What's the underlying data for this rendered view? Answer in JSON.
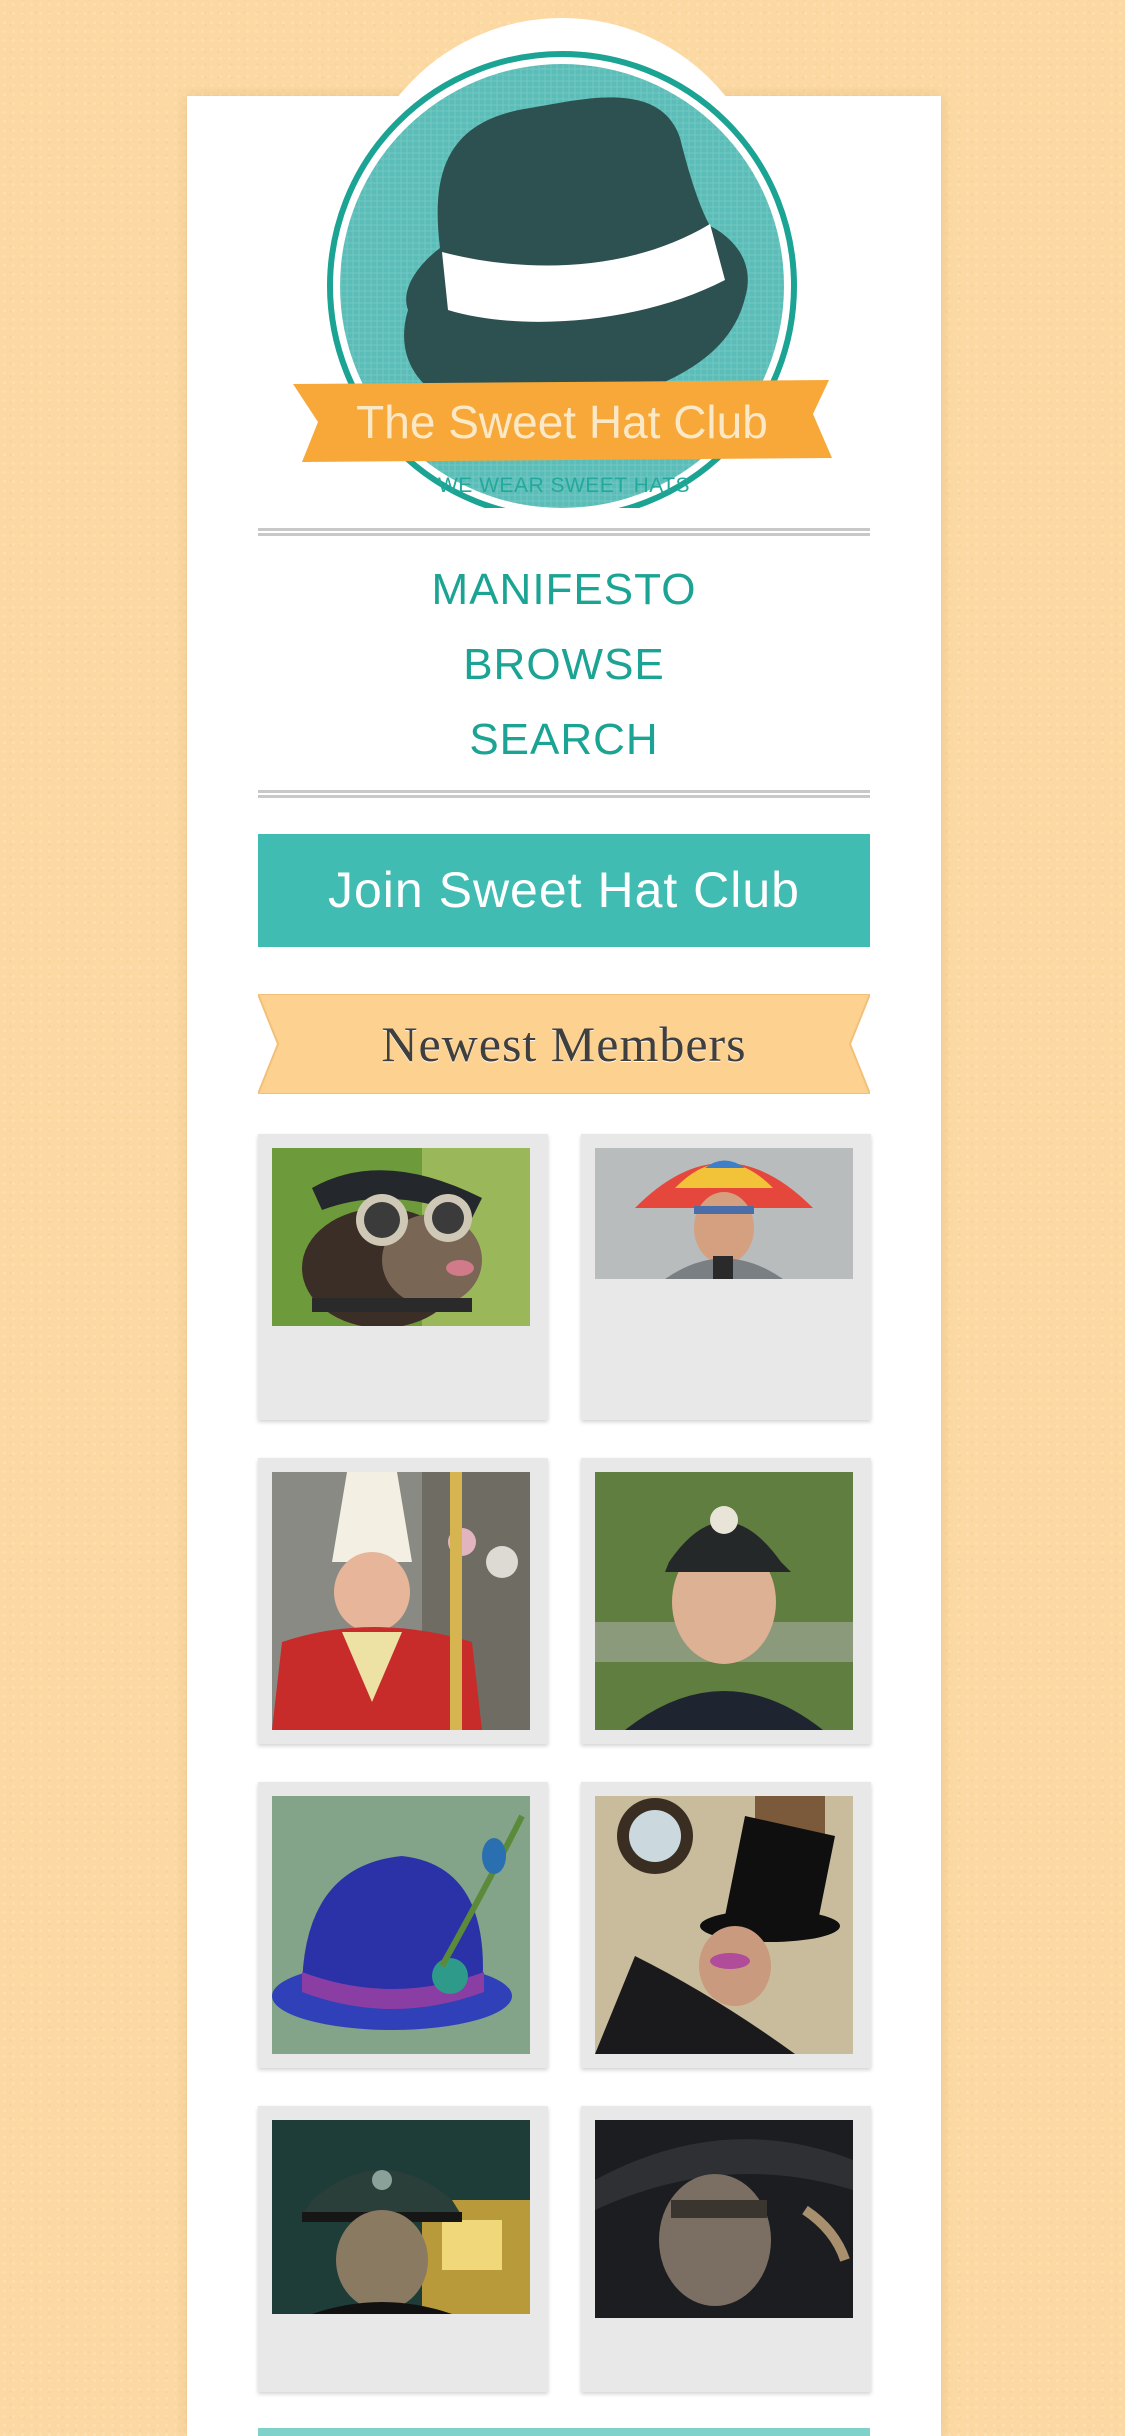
{
  "brand": {
    "name": "The Sweet Hat Club",
    "tagline": "WE WEAR SWEET HATS"
  },
  "nav": {
    "items": [
      {
        "label": "MANIFESTO"
      },
      {
        "label": "BROWSE"
      },
      {
        "label": "SEARCH"
      }
    ]
  },
  "join_button": {
    "label": "Join Sweet Hat Club"
  },
  "members": {
    "title": "Newest Members",
    "items": [
      {
        "alt": "dog in cap and goggles"
      },
      {
        "alt": "man in umbrella hat"
      },
      {
        "alt": "man in mitre"
      },
      {
        "alt": "man in baseball cap"
      },
      {
        "alt": "purple bowler hat with peacock feathers"
      },
      {
        "alt": "man in top hat"
      },
      {
        "alt": "man in military cap"
      },
      {
        "alt": "man in dark fedora"
      }
    ]
  },
  "colors": {
    "teal": "#1ba394",
    "join_bg": "#40bcb2",
    "banner_orange": "#f7a838",
    "members_ribbon": "#fdd18f",
    "background": "#fcd9a3"
  }
}
